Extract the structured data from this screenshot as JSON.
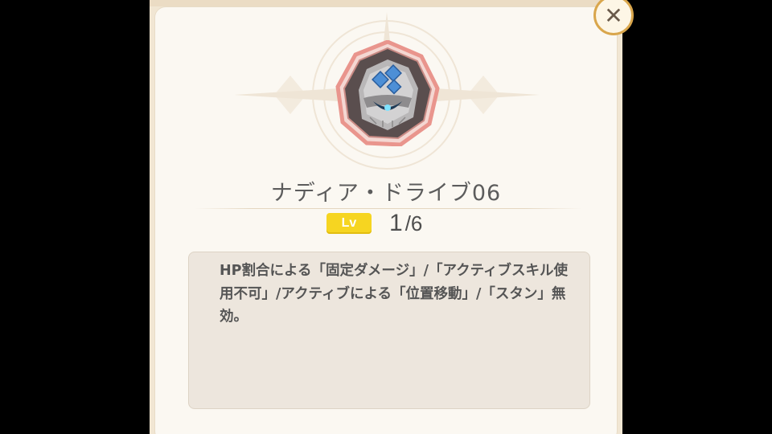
{
  "item": {
    "name": "ナディア・ドライブ06",
    "icon": "golem-emblem-icon"
  },
  "level": {
    "badge": "Lv",
    "current": "1",
    "separator": "/",
    "max": "6"
  },
  "description": "HP割合による「固定ダメージ」/「アクティブスキル使用不可」/アクティブによる「位置移動」/「スタン」無効。",
  "close": {
    "label": "✕",
    "icon": "close-icon"
  },
  "colors": {
    "panel": "#fbf8f2",
    "badge": "#f6d521",
    "emblem_frame": "#e9958d",
    "close_ring": "#d9a64c"
  }
}
